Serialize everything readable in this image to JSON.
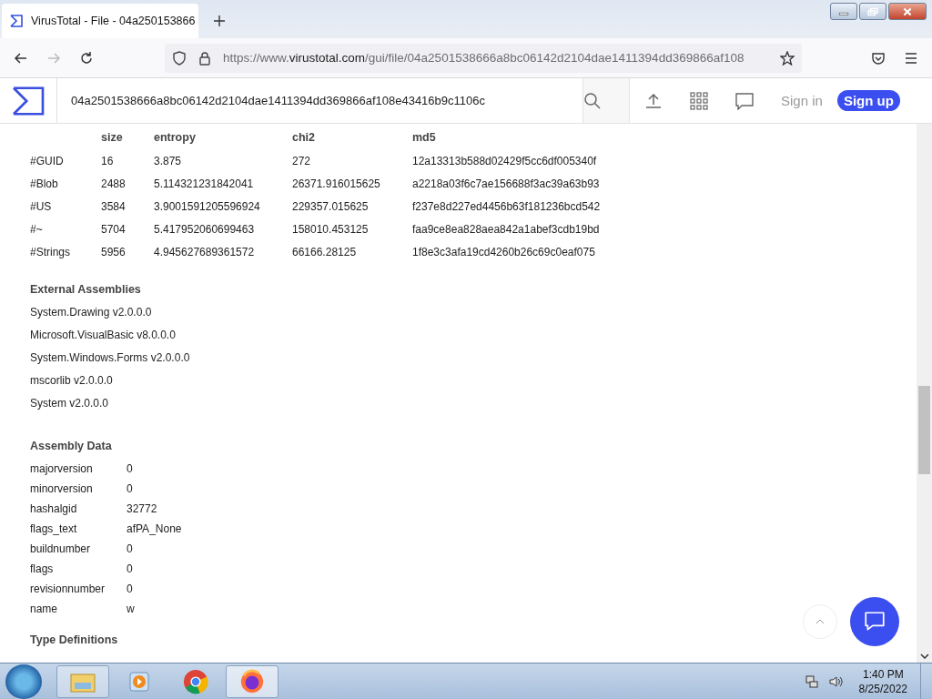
{
  "browser": {
    "tab_title": "VirusTotal - File - 04a250153866",
    "url_prefix": "https://www.",
    "url_domain": "virustotal.com",
    "url_path": "/gui/file/04a2501538666a8bc06142d2104dae1411394dd369866af108"
  },
  "header": {
    "search_value": "04a2501538666a8bc06142d2104dae1411394dd369866af108e43416b9c1106c",
    "sign_in": "Sign in",
    "sign_up": "Sign up"
  },
  "streams": {
    "columns": [
      "",
      "size",
      "entropy",
      "chi2",
      "md5"
    ],
    "rows": [
      [
        "#GUID",
        "16",
        "3.875",
        "272",
        "12a13313b588d02429f5cc6df005340f"
      ],
      [
        "#Blob",
        "2488",
        "5.114321231842041",
        "26371.916015625",
        "a2218a03f6c7ae156688f3ac39a63b93"
      ],
      [
        "#US",
        "3584",
        "3.9001591205596924",
        "229357.015625",
        "f237e8d227ed4456b63f181236bcd542"
      ],
      [
        "#~",
        "5704",
        "5.417952060699463",
        "158010.453125",
        "faa9ce8ea828aea842a1abef3cdb19bd"
      ],
      [
        "#Strings",
        "5956",
        "4.945627689361572",
        "66166.28125",
        "1f8e3c3afa19cd4260b26c69c0eaf075"
      ]
    ]
  },
  "external_assemblies": {
    "title": "External Assemblies",
    "items": [
      "System.Drawing v2.0.0.0",
      "Microsoft.VisualBasic v8.0.0.0",
      "System.Windows.Forms v2.0.0.0",
      "mscorlib v2.0.0.0",
      "System v2.0.0.0"
    ]
  },
  "assembly_data": {
    "title": "Assembly Data",
    "rows": [
      [
        "majorversion",
        "0"
      ],
      [
        "minorversion",
        "0"
      ],
      [
        "hashalgid",
        "32772"
      ],
      [
        "flags_text",
        "afPA_None"
      ],
      [
        "buildnumber",
        "0"
      ],
      [
        "flags",
        "0"
      ],
      [
        "revisionnumber",
        "0"
      ],
      [
        "name",
        "w"
      ]
    ]
  },
  "next_section": {
    "title": "Type Definitions"
  },
  "taskbar": {
    "time": "1:40 PM",
    "date": "8/25/2022"
  }
}
